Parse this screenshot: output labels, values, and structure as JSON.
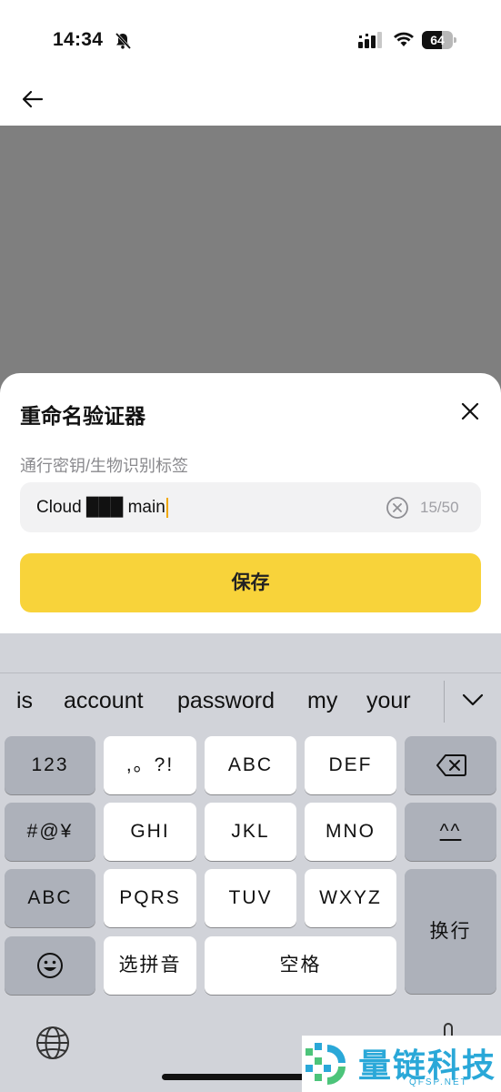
{
  "status_bar": {
    "time": "14:34",
    "battery_percent": "64",
    "battery_level": 0.64
  },
  "nav": {
    "back_icon": "arrow-left-icon"
  },
  "sheet": {
    "title": "重命名验证器",
    "field_label": "通行密钥/生物识别标签",
    "input_value": "Cloud ███ main",
    "char_count": "15/50",
    "save_label": "保存"
  },
  "keyboard": {
    "suggestions": [
      "is",
      "account",
      "password",
      "my",
      "your"
    ],
    "rows": [
      [
        "123",
        ",。?!",
        "ABC",
        "DEF"
      ],
      [
        "#@¥",
        "GHI",
        "JKL",
        "MNO",
        "^^"
      ],
      [
        "ABC",
        "PQRS",
        "TUV",
        "WXYZ",
        "换行"
      ],
      [
        "选拼音",
        "空格"
      ]
    ]
  },
  "watermark": {
    "text": "量链科技",
    "sub": "QFSP.NET"
  }
}
